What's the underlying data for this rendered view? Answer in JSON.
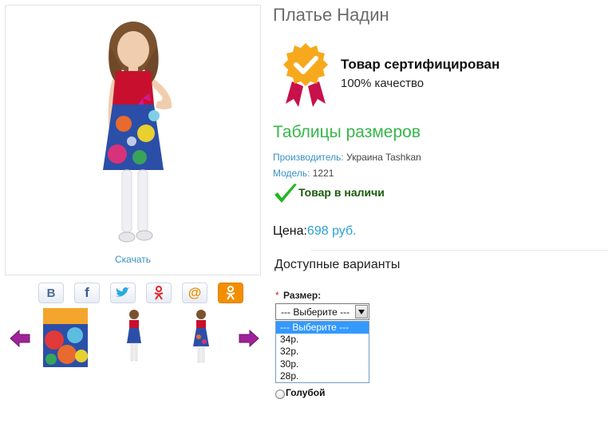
{
  "gallery": {
    "download_label": "Скачать",
    "social_icons": [
      "vk-icon",
      "facebook-icon",
      "twitter-icon",
      "odnoklassniki-icon",
      "mailru-icon",
      "ok-icon"
    ],
    "social_letters": {
      "vk": "В",
      "facebook": "f",
      "mailru": "@"
    },
    "thumbnails": [
      "dress-closeup",
      "girl-full-small",
      "girl-full-small-2"
    ]
  },
  "product": {
    "title": "Платье Надин",
    "cert_title": "Товар сертифицирован",
    "cert_sub": "100% качество",
    "size_table_link": "Таблицы размеров",
    "manufacturer_label": "Производитель:",
    "manufacturer_value": "Украина Tashkan",
    "model_label": "Модель:",
    "model_value": "1221",
    "stock_status": "Товар в наличи",
    "price_label": "Цена:",
    "price_value": "698 руб."
  },
  "variants": {
    "title": "Доступные варианты",
    "required_mark": "*",
    "size_label": "Размер:",
    "selected": "--- Выберите ---",
    "options": [
      "--- Выберите ---",
      "34р.",
      "32р.",
      "30р.",
      "28р."
    ],
    "color_option": "Голубой"
  },
  "colors": {
    "accent_green": "#36b64a",
    "link_blue": "#3a8fc4",
    "price_blue": "#2a9fd6",
    "dropdown_highlight": "#3399ff",
    "arrow_purple": "#a0229a"
  }
}
